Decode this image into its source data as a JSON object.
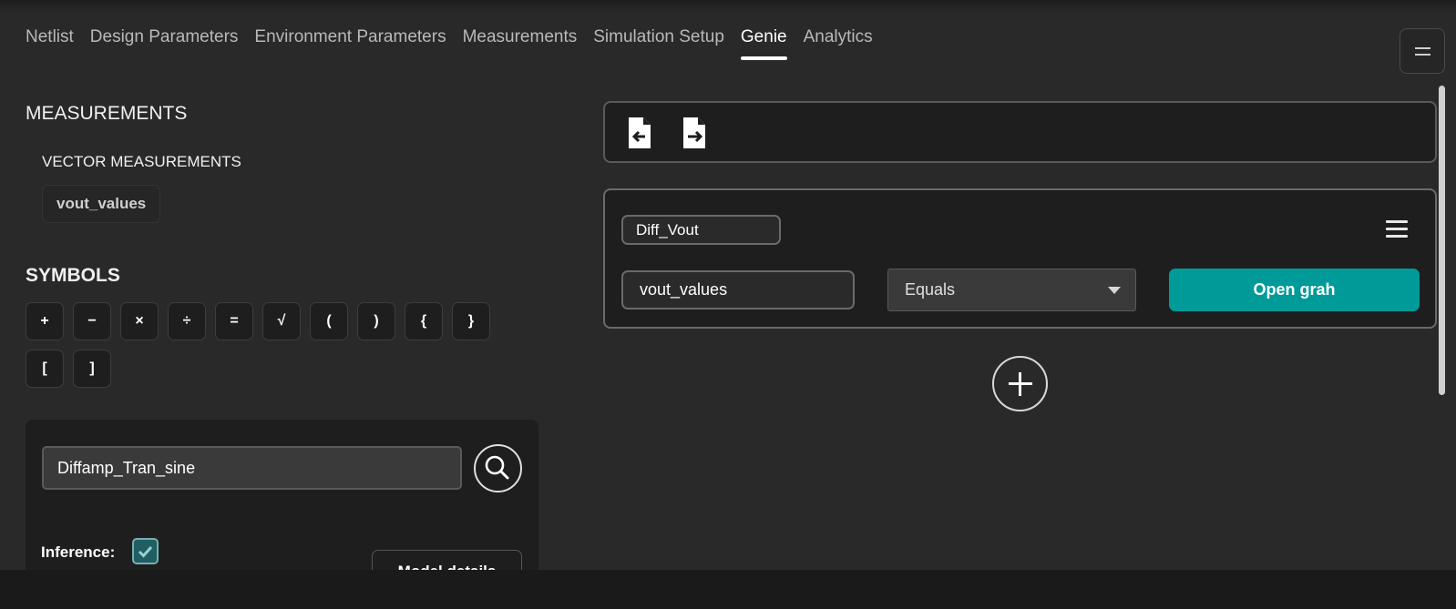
{
  "tabs": [
    {
      "label": "Netlist",
      "active": false
    },
    {
      "label": "Design Parameters",
      "active": false
    },
    {
      "label": "Environment Parameters",
      "active": false
    },
    {
      "label": "Measurements",
      "active": false
    },
    {
      "label": "Simulation Setup",
      "active": false
    },
    {
      "label": "Genie",
      "active": true
    },
    {
      "label": "Analytics",
      "active": false
    }
  ],
  "left": {
    "measurements_title": "MEASUREMENTS",
    "vector_title": "VECTOR MEASUREMENTS",
    "vector_items": [
      "vout_values"
    ],
    "symbols_title": "SYMBOLS",
    "symbols": [
      "+",
      "−",
      "×",
      "÷",
      "=",
      "√",
      "(",
      ")",
      "{",
      "}",
      "[",
      "]"
    ],
    "search_value": "Diffamp_Tran_sine",
    "inference_label": "Inference:",
    "inference_checked": true,
    "model_button_label": "Model details"
  },
  "right": {
    "toolbar": {
      "import_icon": "file-import-icon",
      "export_icon": "file-export-icon"
    },
    "card": {
      "name_value": "Diff_Vout",
      "variable_value": "vout_values",
      "operator_value": "Equals",
      "open_button_label": "Open grah"
    }
  },
  "colors": {
    "accent": "#009a99",
    "background": "#292929",
    "panel": "#1e1e1e"
  }
}
